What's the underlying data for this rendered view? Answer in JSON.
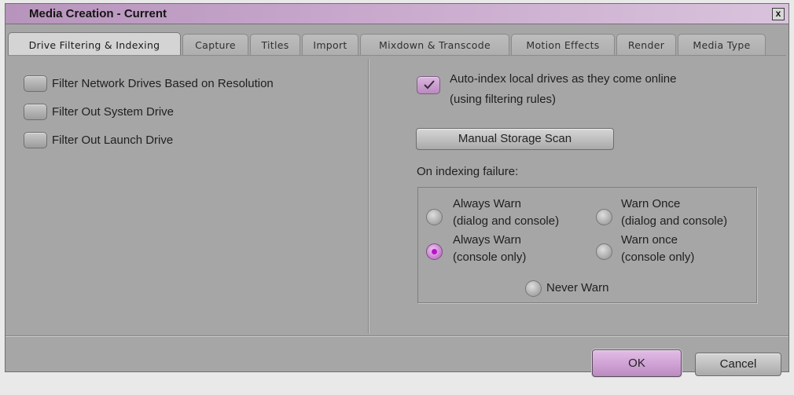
{
  "window": {
    "title": "Media Creation - Current",
    "close_glyph": "x"
  },
  "tabs": [
    {
      "label": "Drive Filtering & Indexing",
      "active": true
    },
    {
      "label": "Capture"
    },
    {
      "label": "Titles"
    },
    {
      "label": "Import"
    },
    {
      "label": "Mixdown & Transcode"
    },
    {
      "label": "Motion Effects"
    },
    {
      "label": "Render"
    },
    {
      "label": "Media Type"
    }
  ],
  "left": {
    "options": [
      {
        "label": "Filter Network Drives Based on Resolution",
        "checked": false
      },
      {
        "label": "Filter Out System Drive",
        "checked": false
      },
      {
        "label": "Filter Out Launch Drive",
        "checked": false
      }
    ]
  },
  "right": {
    "auto_index": {
      "line1": "Auto-index local drives as they come online",
      "line2": "(using filtering rules)",
      "checked": true,
      "icon": "checkmark-icon"
    },
    "scan_button": "Manual Storage Scan",
    "failure_label": "On indexing failure:",
    "radios": [
      {
        "line1": "Always Warn",
        "line2": "(dialog and console)",
        "selected": false
      },
      {
        "line1": "Warn Once",
        "line2": "(dialog and console)",
        "selected": false
      },
      {
        "line1": "Always Warn",
        "line2": "(console only)",
        "selected": true
      },
      {
        "line1": "Warn once",
        "line2": "(console only)",
        "selected": false
      },
      {
        "line1": "Never Warn",
        "selected": false
      }
    ]
  },
  "footer": {
    "ok": "OK",
    "cancel": "Cancel"
  },
  "colors": {
    "accent": "#c89ccd",
    "radio_selected_dot": "#b316c2",
    "panel_bg": "#a6a6a6"
  }
}
